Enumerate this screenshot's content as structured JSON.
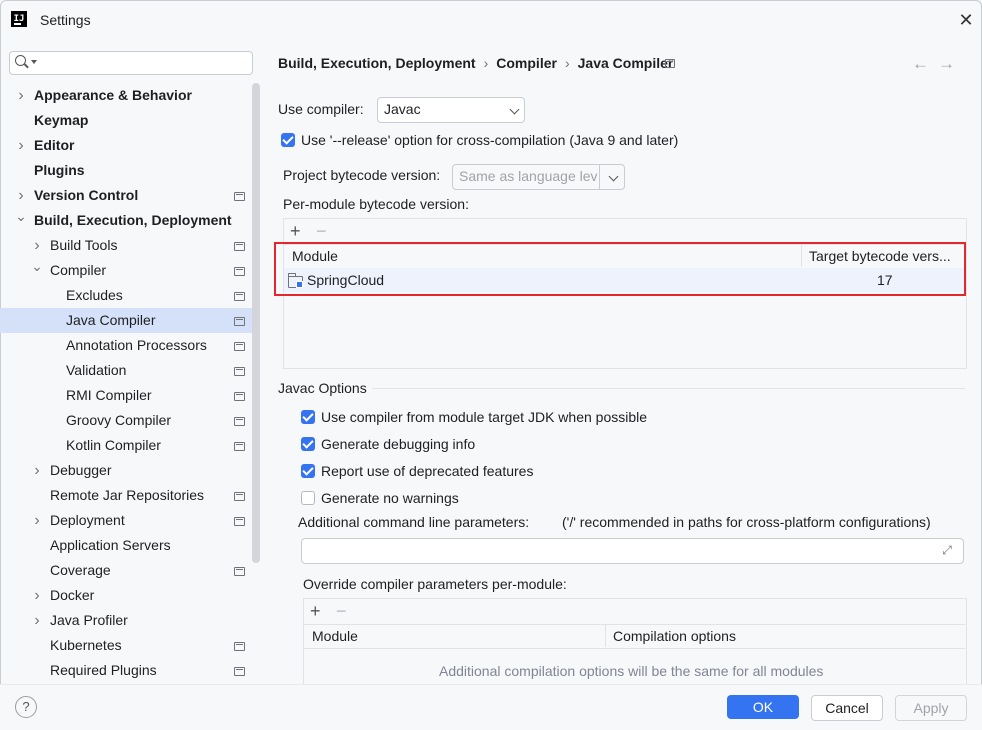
{
  "window": {
    "title": "Settings",
    "app_icon_text": "IJ"
  },
  "sidebar": {
    "search_placeholder": "",
    "items": [
      {
        "label": "Appearance & Behavior",
        "bold": true,
        "expandable": "collapsed",
        "project_icon": false
      },
      {
        "label": "Keymap",
        "bold": true,
        "expandable": "none",
        "project_icon": false
      },
      {
        "label": "Editor",
        "bold": true,
        "expandable": "collapsed",
        "project_icon": false
      },
      {
        "label": "Plugins",
        "bold": true,
        "expandable": "none",
        "project_icon": false
      },
      {
        "label": "Version Control",
        "bold": true,
        "expandable": "collapsed",
        "project_icon": true
      },
      {
        "label": "Build, Execution, Deployment",
        "bold": true,
        "expandable": "expanded",
        "project_icon": false
      },
      {
        "label": "Build Tools",
        "bold": false,
        "expandable": "collapsed",
        "project_icon": true
      },
      {
        "label": "Compiler",
        "bold": false,
        "expandable": "expanded",
        "project_icon": true
      },
      {
        "label": "Excludes",
        "bold": false,
        "expandable": "none",
        "project_icon": true
      },
      {
        "label": "Java Compiler",
        "bold": false,
        "expandable": "none",
        "project_icon": true,
        "selected": true
      },
      {
        "label": "Annotation Processors",
        "bold": false,
        "expandable": "none",
        "project_icon": true
      },
      {
        "label": "Validation",
        "bold": false,
        "expandable": "none",
        "project_icon": true
      },
      {
        "label": "RMI Compiler",
        "bold": false,
        "expandable": "none",
        "project_icon": true
      },
      {
        "label": "Groovy Compiler",
        "bold": false,
        "expandable": "none",
        "project_icon": true
      },
      {
        "label": "Kotlin Compiler",
        "bold": false,
        "expandable": "none",
        "project_icon": true
      },
      {
        "label": "Debugger",
        "bold": false,
        "expandable": "collapsed",
        "project_icon": false
      },
      {
        "label": "Remote Jar Repositories",
        "bold": false,
        "expandable": "none",
        "project_icon": true
      },
      {
        "label": "Deployment",
        "bold": false,
        "expandable": "collapsed",
        "project_icon": true
      },
      {
        "label": "Application Servers",
        "bold": false,
        "expandable": "none",
        "project_icon": false
      },
      {
        "label": "Coverage",
        "bold": false,
        "expandable": "none",
        "project_icon": true
      },
      {
        "label": "Docker",
        "bold": false,
        "expandable": "collapsed",
        "project_icon": false
      },
      {
        "label": "Java Profiler",
        "bold": false,
        "expandable": "collapsed",
        "project_icon": false
      },
      {
        "label": "Kubernetes",
        "bold": false,
        "expandable": "none",
        "project_icon": true
      },
      {
        "label": "Required Plugins",
        "bold": false,
        "expandable": "none",
        "project_icon": true
      }
    ]
  },
  "breadcrumb": {
    "items": [
      "Build, Execution, Deployment",
      "Compiler",
      "Java Compiler"
    ],
    "separator": "›"
  },
  "nav": {
    "back": "←",
    "forward": "→"
  },
  "main": {
    "use_compiler_label": "Use compiler:",
    "use_compiler_value": "Javac",
    "release_option_label": "Use '--release' option for cross-compilation (Java 9 and later)",
    "release_option_checked": true,
    "project_bytecode_label": "Project bytecode version:",
    "project_bytecode_value": "Same as language level",
    "per_module_label": "Per-module bytecode version:",
    "module_table": {
      "add": "+",
      "remove": "−",
      "columns": [
        "Module",
        "Target bytecode vers..."
      ],
      "rows": [
        {
          "module": "SpringCloud",
          "target": "17"
        }
      ]
    },
    "javac_options_title": "Javac Options",
    "javac_checkboxes": [
      {
        "label": "Use compiler from module target JDK when possible",
        "checked": true
      },
      {
        "label": "Generate debugging info",
        "checked": true
      },
      {
        "label": "Report use of deprecated features",
        "checked": true
      },
      {
        "label": "Generate no warnings",
        "checked": false
      }
    ],
    "additional_params_label": "Additional command line parameters:",
    "additional_params_hint": "('/' recommended in paths for cross-platform configurations)",
    "additional_params_value": "",
    "override_label": "Override compiler parameters per-module:",
    "override_table": {
      "add": "+",
      "remove": "−",
      "columns": [
        "Module",
        "Compilation options"
      ],
      "empty_text": "Additional compilation options will be the same for all modules"
    }
  },
  "footer": {
    "help": "?",
    "ok": "OK",
    "cancel": "Cancel",
    "apply": "Apply"
  },
  "colors": {
    "accent": "#3574f0",
    "selection": "#d5e1f8",
    "highlight_border": "#e0282e",
    "background": "#f7f8fa"
  }
}
